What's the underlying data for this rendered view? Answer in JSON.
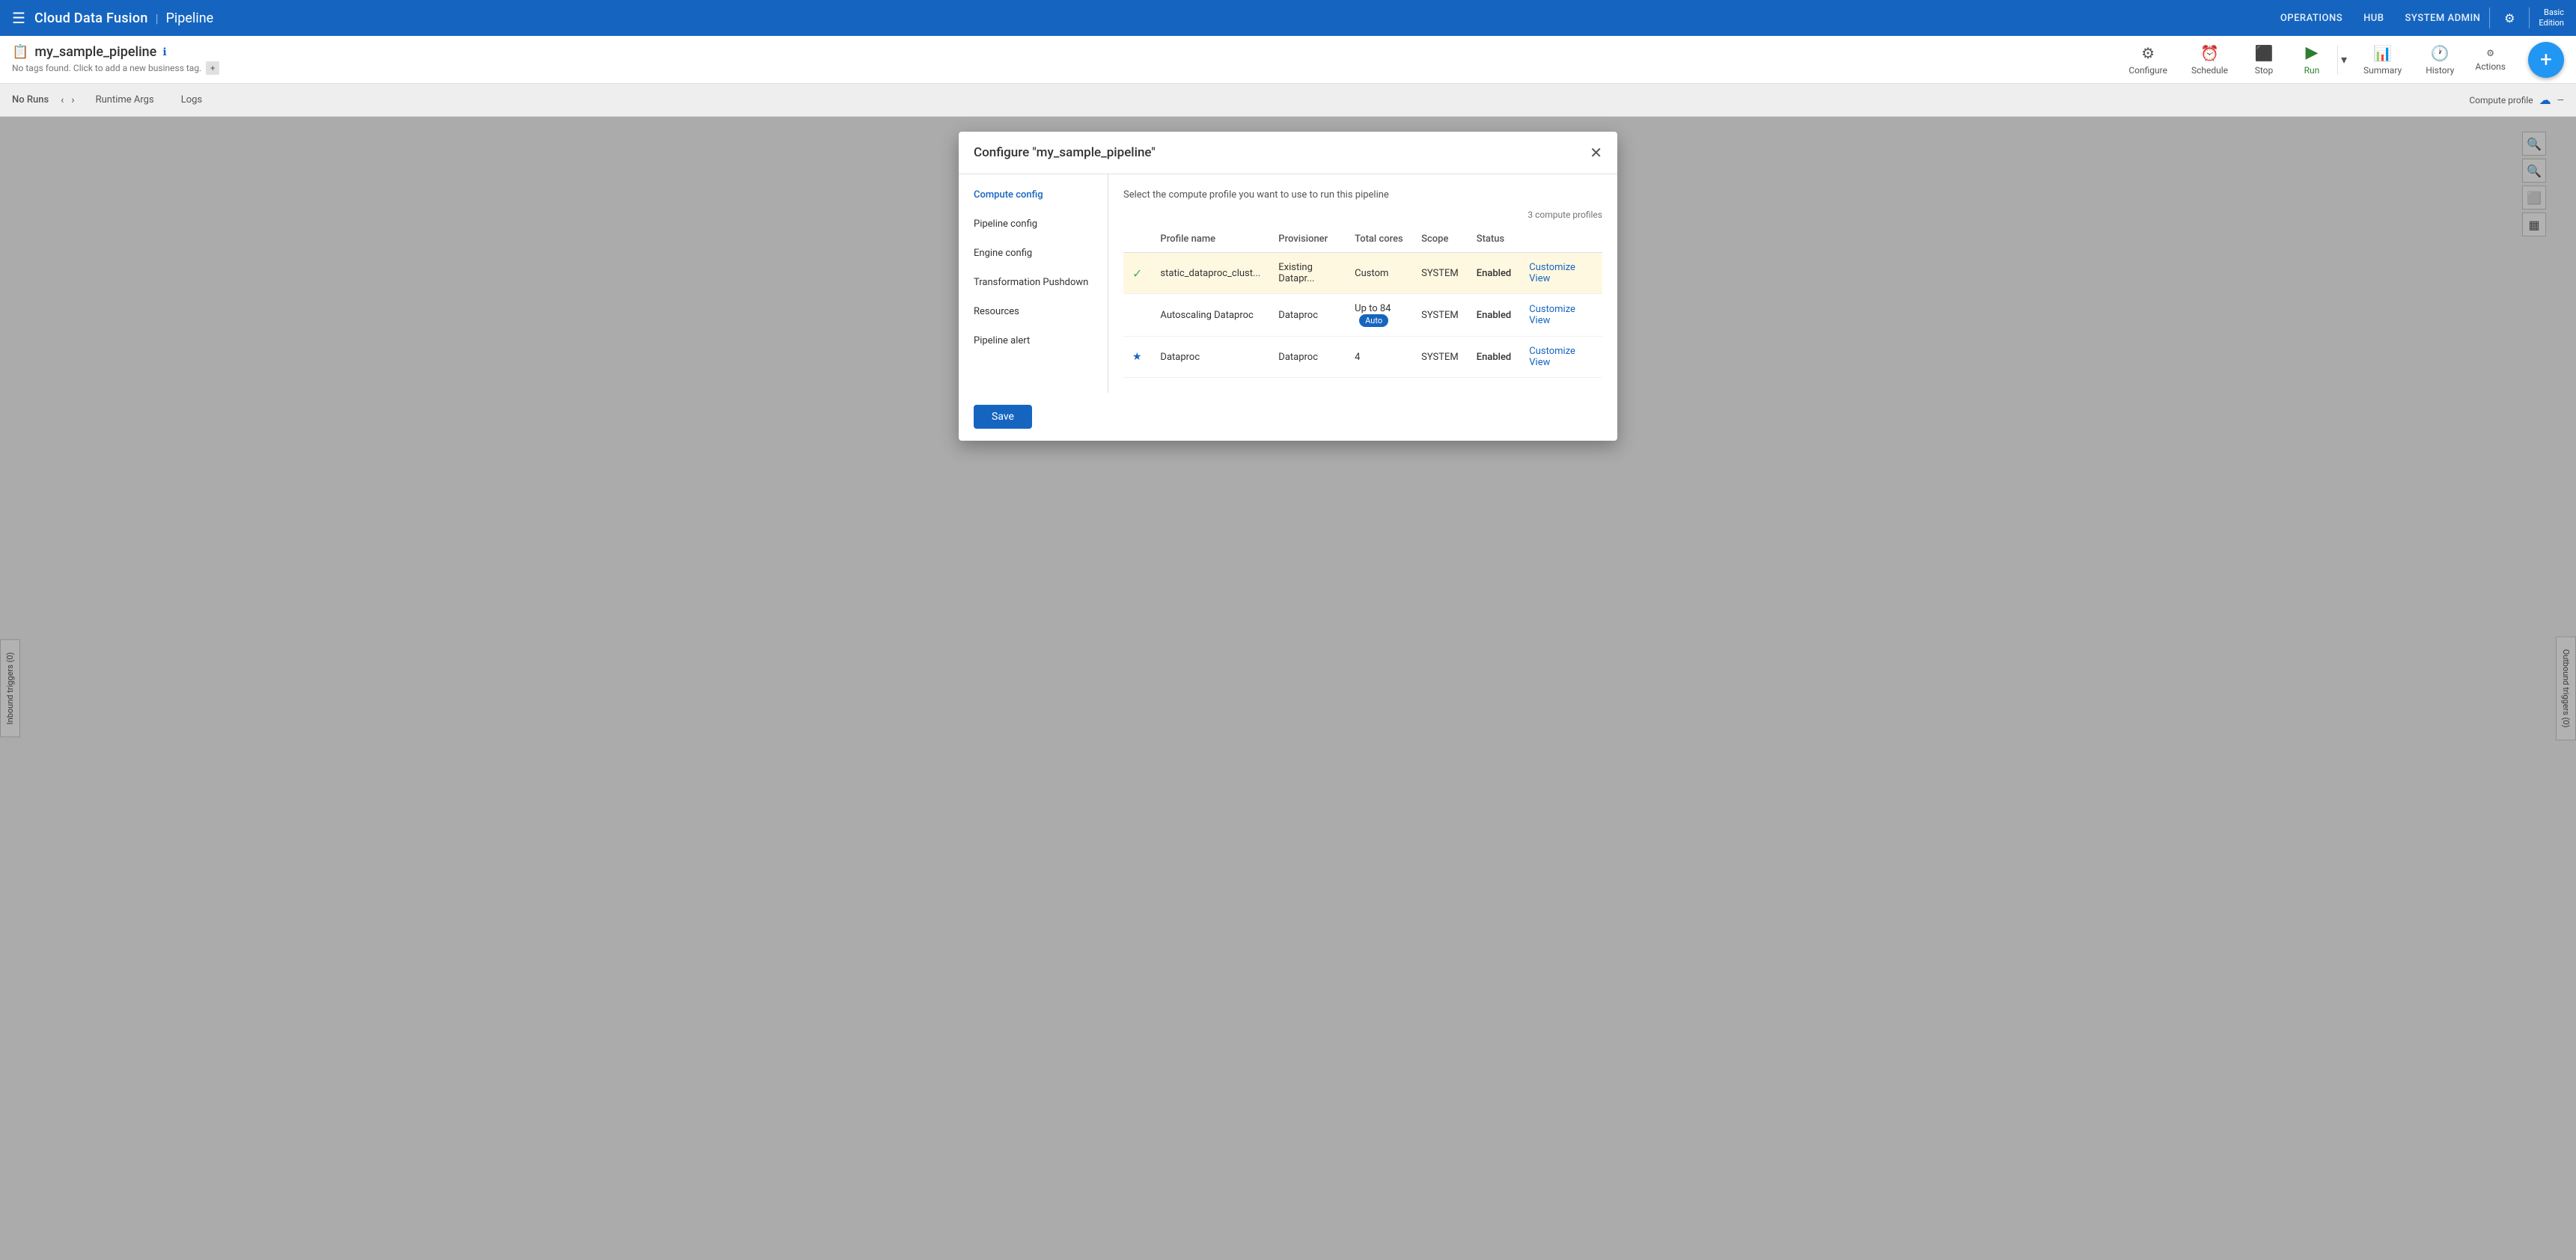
{
  "topNav": {
    "menuIcon": "☰",
    "brand": "Cloud Data Fusion",
    "separator": "|",
    "section": "Pipeline",
    "links": [
      "OPERATIONS",
      "HUB",
      "SYSTEM ADMIN"
    ],
    "settingsIcon": "⚙",
    "editionLine1": "Basic",
    "editionLine2": "Edition"
  },
  "pipelineToolbar": {
    "pipelineIcon": "≡",
    "pipelineName": "my_sample_pipeline",
    "infoIconLabel": "ℹ",
    "noTagsText": "No tags found. Click to add a new business tag.",
    "addTagLabel": "+",
    "buttons": {
      "configure": {
        "label": "Configure",
        "icon": "⚙"
      },
      "schedule": {
        "label": "Schedule",
        "icon": "⏰"
      },
      "stop": {
        "label": "Stop",
        "icon": "⬛"
      },
      "run": {
        "label": "Run",
        "icon": "▶"
      },
      "summary": {
        "label": "Summary",
        "icon": "📊"
      },
      "history": {
        "label": "History",
        "icon": "🕐"
      },
      "actions": {
        "label": "Actions",
        "icon": "⚙"
      }
    },
    "fabIcon": "+"
  },
  "runsBar": {
    "noRunsLabel": "No Runs",
    "prevIcon": "‹",
    "nextIcon": "›",
    "runtimeArgsLabel": "Runtime Args",
    "logsLabel": "Logs",
    "computeProfileLabel": "Compute profile",
    "cloudIcon": "☁"
  },
  "modal": {
    "title": "Configure \"my_sample_pipeline\"",
    "closeIcon": "✕",
    "navItems": [
      {
        "label": "Compute config",
        "active": true
      },
      {
        "label": "Pipeline config",
        "active": false
      },
      {
        "label": "Engine config",
        "active": false
      },
      {
        "label": "Transformation Pushdown",
        "active": false
      },
      {
        "label": "Resources",
        "active": false
      },
      {
        "label": "Pipeline alert",
        "active": false
      }
    ],
    "description": "Select the compute profile you want to use to run this pipeline",
    "profilesCount": "3 compute profiles",
    "tableHeaders": [
      "Profile name",
      "Provisioner",
      "Total cores",
      "Scope",
      "Status"
    ],
    "profiles": [
      {
        "selected": true,
        "checkmark": "✓",
        "name": "static_dataproc_clust...",
        "provisioner": "Existing Datapr...",
        "totalCores": "Custom",
        "scope": "SYSTEM",
        "status": "Enabled",
        "customizeLabel": "Customize",
        "viewLabel": "View",
        "hasStar": false,
        "hasAuto": false
      },
      {
        "selected": false,
        "checkmark": "",
        "name": "Autoscaling Dataproc",
        "provisioner": "Dataproc",
        "totalCores": "Up to 84",
        "scope": "SYSTEM",
        "status": "Enabled",
        "customizeLabel": "Customize",
        "viewLabel": "View",
        "hasStar": false,
        "hasAuto": true
      },
      {
        "selected": false,
        "checkmark": "",
        "name": "Dataproc",
        "provisioner": "Dataproc",
        "totalCores": "4",
        "scope": "SYSTEM",
        "status": "Enabled",
        "customizeLabel": "Customize",
        "viewLabel": "View",
        "hasStar": true,
        "hasAuto": false
      }
    ],
    "saveLabel": "Save"
  },
  "sidePanel": {
    "inboundLabel": "Inbound triggers (0)",
    "outboundLabel": "Outbound triggers (0)"
  }
}
